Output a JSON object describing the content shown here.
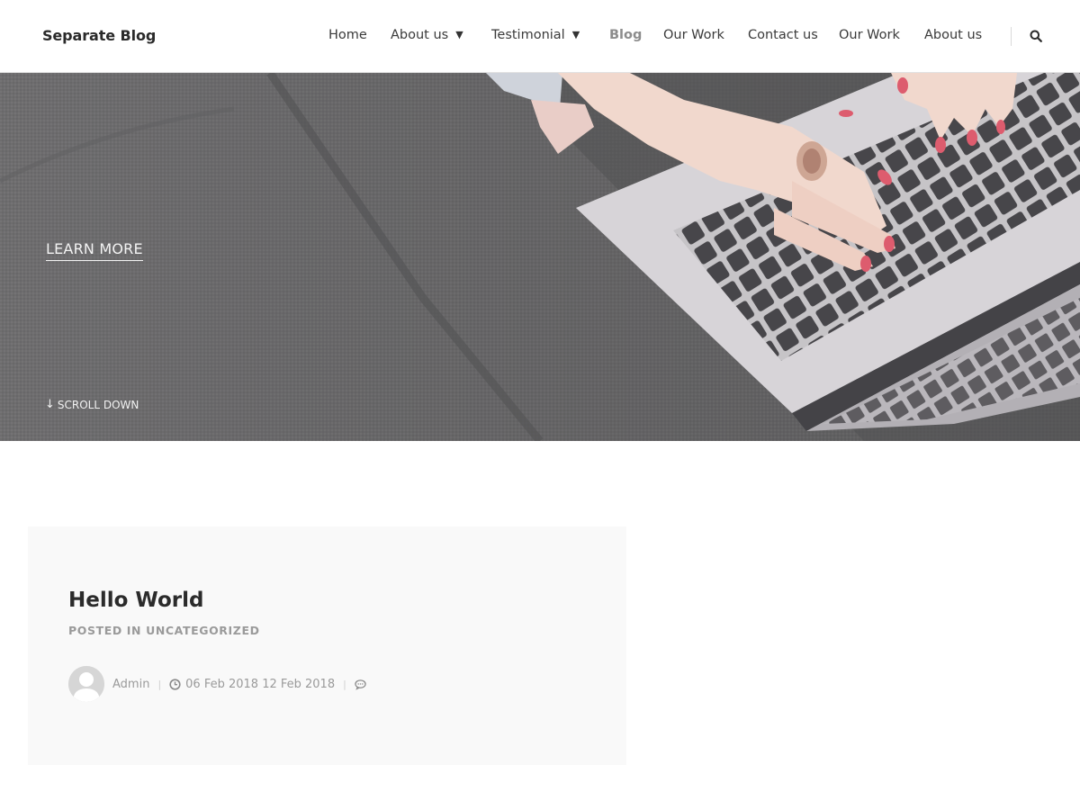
{
  "site": {
    "title": "Separate Blog"
  },
  "nav": {
    "items": [
      {
        "label": "Home"
      },
      {
        "label": "About us"
      },
      {
        "label": "Testimonial"
      },
      {
        "label": "Blog"
      },
      {
        "label": "Our Work"
      },
      {
        "label": "Contact us"
      },
      {
        "label": "Our Work"
      },
      {
        "label": "About us"
      }
    ],
    "active_item": "Blog",
    "dropdown_caret": "▼"
  },
  "hero": {
    "learn_more": "LEARN MORE",
    "scroll_down": "SCROLL DOWN",
    "scroll_arrow": "↓"
  },
  "post": {
    "title": "Hello World",
    "posted_in_label": "POSTED IN",
    "category": "UNCATEGORIZED",
    "author": "Admin",
    "dates": "06 Feb 2018 12 Feb 2018",
    "separator": "|"
  },
  "icons": {
    "search": "search-icon",
    "clock": "clock-icon",
    "comment": "comment-icon",
    "avatar": "user-avatar"
  },
  "colors": {
    "active_nav": "#8c8c8c",
    "meta_text": "#9a9a9a",
    "card_bg": "#f9f9f9",
    "title": "#2b2b2b"
  }
}
